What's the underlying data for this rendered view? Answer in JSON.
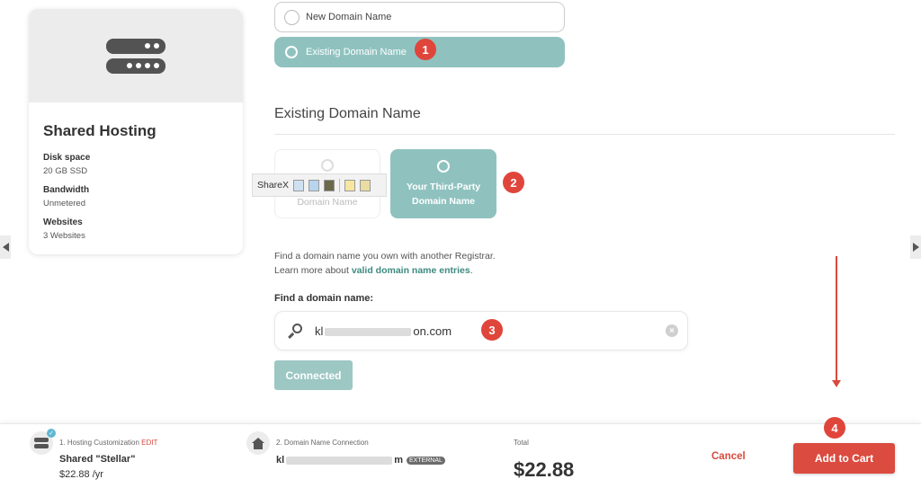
{
  "domain_options": {
    "new_label": "New Domain Name",
    "existing_label": "Existing Domain Name"
  },
  "annotations": {
    "one": "1",
    "two": "2",
    "three": "3",
    "four": "4"
  },
  "hosting_card": {
    "title": "Shared Hosting",
    "specs": [
      {
        "label": "Disk space",
        "value": "20 GB SSD"
      },
      {
        "label": "Bandwidth",
        "value": "Unmetered"
      },
      {
        "label": "Websites",
        "value": "3 Websites"
      }
    ]
  },
  "section": {
    "title": "Existing Domain Name"
  },
  "registrar_tiles": {
    "ours_label": "Domain Name",
    "third_party_label": "Your Third-Party Domain Name"
  },
  "sharex": {
    "label": "ShareX"
  },
  "info": {
    "line1": "Find a domain name you own with another Registrar.",
    "line2_prefix": "Learn more about ",
    "line2_link": "valid domain name entries",
    "line2_suffix": "."
  },
  "search": {
    "label": "Find a domain name:",
    "value_prefix": "kl",
    "value_suffix": "on.com",
    "clear_icon": "×"
  },
  "connected_button": "Connected",
  "footer": {
    "step1_label": "1. Hosting Customization",
    "step1_edit": "EDIT",
    "plan_name": "Shared \"Stellar\"",
    "plan_price": "$22.88 /yr",
    "step2_label": "2. Domain Name Connection",
    "domain_prefix": "kl",
    "domain_suffix": "m",
    "external_badge": "EXTERNAL",
    "total_label": "Total",
    "total_value": "$22.88",
    "cancel_label": "Cancel",
    "add_to_cart_label": "Add to Cart"
  },
  "colors": {
    "accent_teal": "#8fc2bf",
    "brand_red": "#db4b3f",
    "link_green": "#3d8a80"
  },
  "icons": [
    "server-icon",
    "search-icon",
    "clear-icon",
    "home-icon",
    "check-icon",
    "arrow-left-icon",
    "arrow-right-icon"
  ]
}
